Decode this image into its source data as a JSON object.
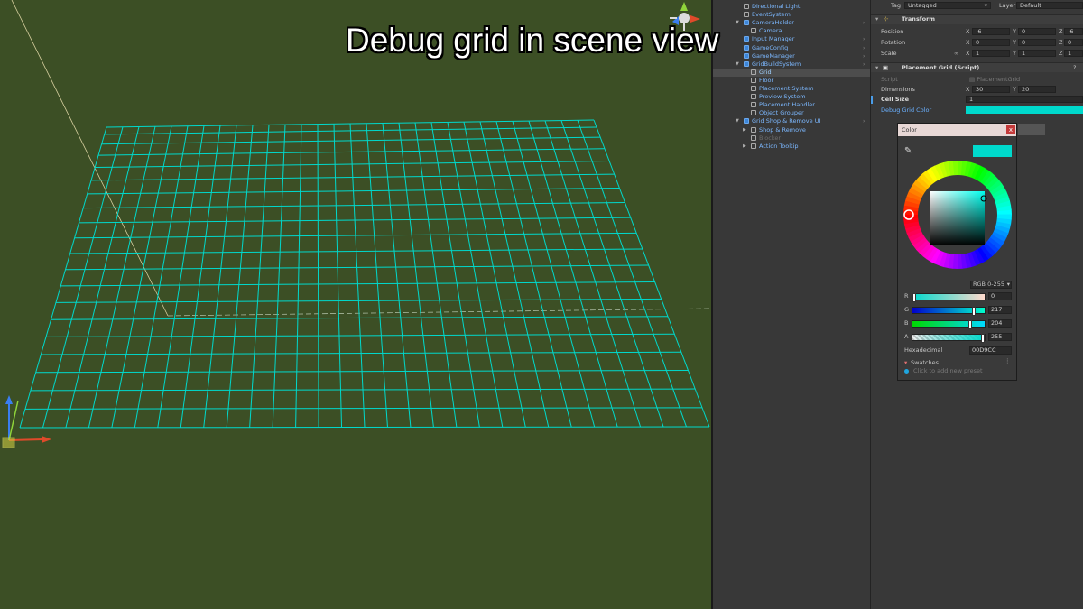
{
  "caption": "Debug grid in scene view",
  "scene": {
    "grid_color": "#00D9CC",
    "grid_columns": 30,
    "grid_rows": 20
  },
  "hierarchy": {
    "items": [
      {
        "label": "Directional Light",
        "indent": 1,
        "icon": "cube"
      },
      {
        "label": "EventSystem",
        "indent": 1,
        "icon": "cube"
      },
      {
        "label": "CameraHolder",
        "indent": 1,
        "icon": "blue-cube",
        "fold": "open"
      },
      {
        "label": "Camera",
        "indent": 2,
        "icon": "cube"
      },
      {
        "label": "Input Manager",
        "indent": 1,
        "icon": "blue-cube"
      },
      {
        "label": "GameConfig",
        "indent": 1,
        "icon": "blue-cube"
      },
      {
        "label": "GameManager",
        "indent": 1,
        "icon": "blue-cube"
      },
      {
        "label": "GridBuildSystem",
        "indent": 1,
        "icon": "blue-cube",
        "fold": "open"
      },
      {
        "label": "Grid",
        "indent": 2,
        "icon": "cube",
        "selected": true
      },
      {
        "label": "Floor",
        "indent": 2,
        "icon": "cube"
      },
      {
        "label": "Placement System",
        "indent": 2,
        "icon": "cube"
      },
      {
        "label": "Preview System",
        "indent": 2,
        "icon": "cube"
      },
      {
        "label": "Placement Handler",
        "indent": 2,
        "icon": "cube"
      },
      {
        "label": "Object Grouper",
        "indent": 2,
        "icon": "cube"
      },
      {
        "label": "Grid Shop & Remove UI",
        "indent": 1,
        "icon": "blue-cube",
        "fold": "open"
      },
      {
        "label": "Shop & Remove",
        "indent": 2,
        "icon": "cube",
        "fold": "closed"
      },
      {
        "label": "Blocker",
        "indent": 2,
        "icon": "cube",
        "dim": true
      },
      {
        "label": "Action Tooltip",
        "indent": 2,
        "icon": "cube",
        "fold": "closed"
      }
    ]
  },
  "inspector": {
    "tag_label": "Tag",
    "tag_value": "Untagged",
    "layer_label": "Layer",
    "layer_value": "Default",
    "transform_title": "Transform",
    "position_label": "Position",
    "rotation_label": "Rotation",
    "scale_label": "Scale",
    "position": {
      "x": "-6",
      "y": "0",
      "z": "-6"
    },
    "rotation": {
      "x": "0",
      "y": "0",
      "z": "0"
    },
    "scale": {
      "x": "1",
      "y": "1",
      "z": "1"
    },
    "script_component_title": "Placement Grid (Script)",
    "script_label": "Script",
    "script_value": "PlacementGrid",
    "dimensions_label": "Dimensions",
    "dimensions": {
      "x": "30",
      "y": "20"
    },
    "cell_size_label": "Cell Size",
    "cell_size_value": "1",
    "debug_color_label": "Debug Grid Color",
    "debug_color": "#00D9CC"
  },
  "color_picker": {
    "title": "Color",
    "close_label": "x",
    "mode": "RGB 0-255",
    "channels": [
      {
        "label": "R",
        "value": "0"
      },
      {
        "label": "G",
        "value": "217"
      },
      {
        "label": "B",
        "value": "204"
      },
      {
        "label": "A",
        "value": "255"
      }
    ],
    "hex_label": "Hexadecimal",
    "hex_value": "00D9CC",
    "swatches_label": "Swatches",
    "swatches_hint": "Click to add new preset",
    "current_color": "#00D9CC"
  }
}
